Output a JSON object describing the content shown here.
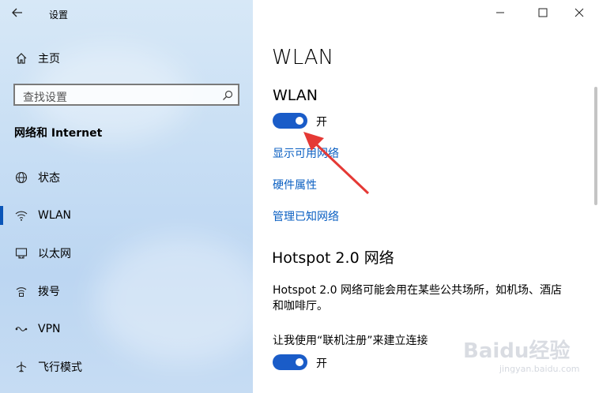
{
  "window": {
    "title": "设置"
  },
  "sidebar": {
    "home_label": "主页",
    "search_placeholder": "查找设置",
    "section_title": "网络和 Internet",
    "items": [
      {
        "label": "状态",
        "icon": "globe-icon"
      },
      {
        "label": "WLAN",
        "icon": "wifi-icon",
        "selected": true
      },
      {
        "label": "以太网",
        "icon": "ethernet-icon"
      },
      {
        "label": "拨号",
        "icon": "dialup-icon"
      },
      {
        "label": "VPN",
        "icon": "vpn-icon"
      },
      {
        "label": "飞行模式",
        "icon": "airplane-icon"
      }
    ]
  },
  "main": {
    "page_title": "WLAN",
    "wlan_heading": "WLAN",
    "wlan_toggle_state": "开",
    "links": [
      "显示可用网络",
      "硬件属性",
      "管理已知网络"
    ],
    "hotspot_heading": "Hotspot 2.0 网络",
    "hotspot_desc_line1": "Hotspot 2.0 网络可能会用在某些公共场所，如机场、酒店",
    "hotspot_desc_line2": "和咖啡厅。",
    "online_signup_label": "让我使用“联机注册”来建立连接",
    "online_signup_state": "开"
  },
  "watermark": {
    "brand": "Baidu经验",
    "site": "jingyan.baidu.com"
  },
  "colors": {
    "accent": "#1a5cc8",
    "link": "#0a5fc2",
    "arrow": "#e53935"
  }
}
